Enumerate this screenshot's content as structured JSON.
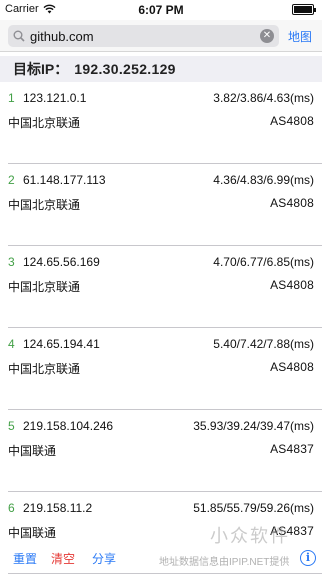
{
  "status_bar": {
    "carrier": "Carrier",
    "time": "6:07 PM"
  },
  "search": {
    "query": "github.com",
    "map_label": "地图"
  },
  "target": {
    "label": "目标IP：",
    "ip": "192.30.252.129"
  },
  "hops": [
    {
      "num": "1",
      "ip": "123.121.0.1",
      "rtt": "3.82/3.86/4.63(ms)",
      "location": "中国北京联通",
      "asn": "AS4808"
    },
    {
      "num": "2",
      "ip": "61.148.177.113",
      "rtt": "4.36/4.83/6.99(ms)",
      "location": "中国北京联通",
      "asn": "AS4808"
    },
    {
      "num": "3",
      "ip": "124.65.56.169",
      "rtt": "4.70/6.77/6.85(ms)",
      "location": "中国北京联通",
      "asn": "AS4808"
    },
    {
      "num": "4",
      "ip": "124.65.194.41",
      "rtt": "5.40/7.42/7.88(ms)",
      "location": "中国北京联通",
      "asn": "AS4808"
    },
    {
      "num": "5",
      "ip": "219.158.104.246",
      "rtt": "35.93/39.24/39.47(ms)",
      "location": "中国联通",
      "asn": "AS4837"
    },
    {
      "num": "6",
      "ip": "219.158.11.2",
      "rtt": "51.85/55.79/59.26(ms)",
      "location": "中国联通",
      "asn": "AS4837"
    }
  ],
  "toolbar": {
    "reset": "重置",
    "clear": "清空",
    "share": "分享",
    "credit": "地址数据信息由IPIP.NET提供"
  },
  "watermark": "小众软件",
  "colors": {
    "accent": "#2a79f5",
    "hop_number": "#43a047",
    "clear": "#e53935"
  }
}
